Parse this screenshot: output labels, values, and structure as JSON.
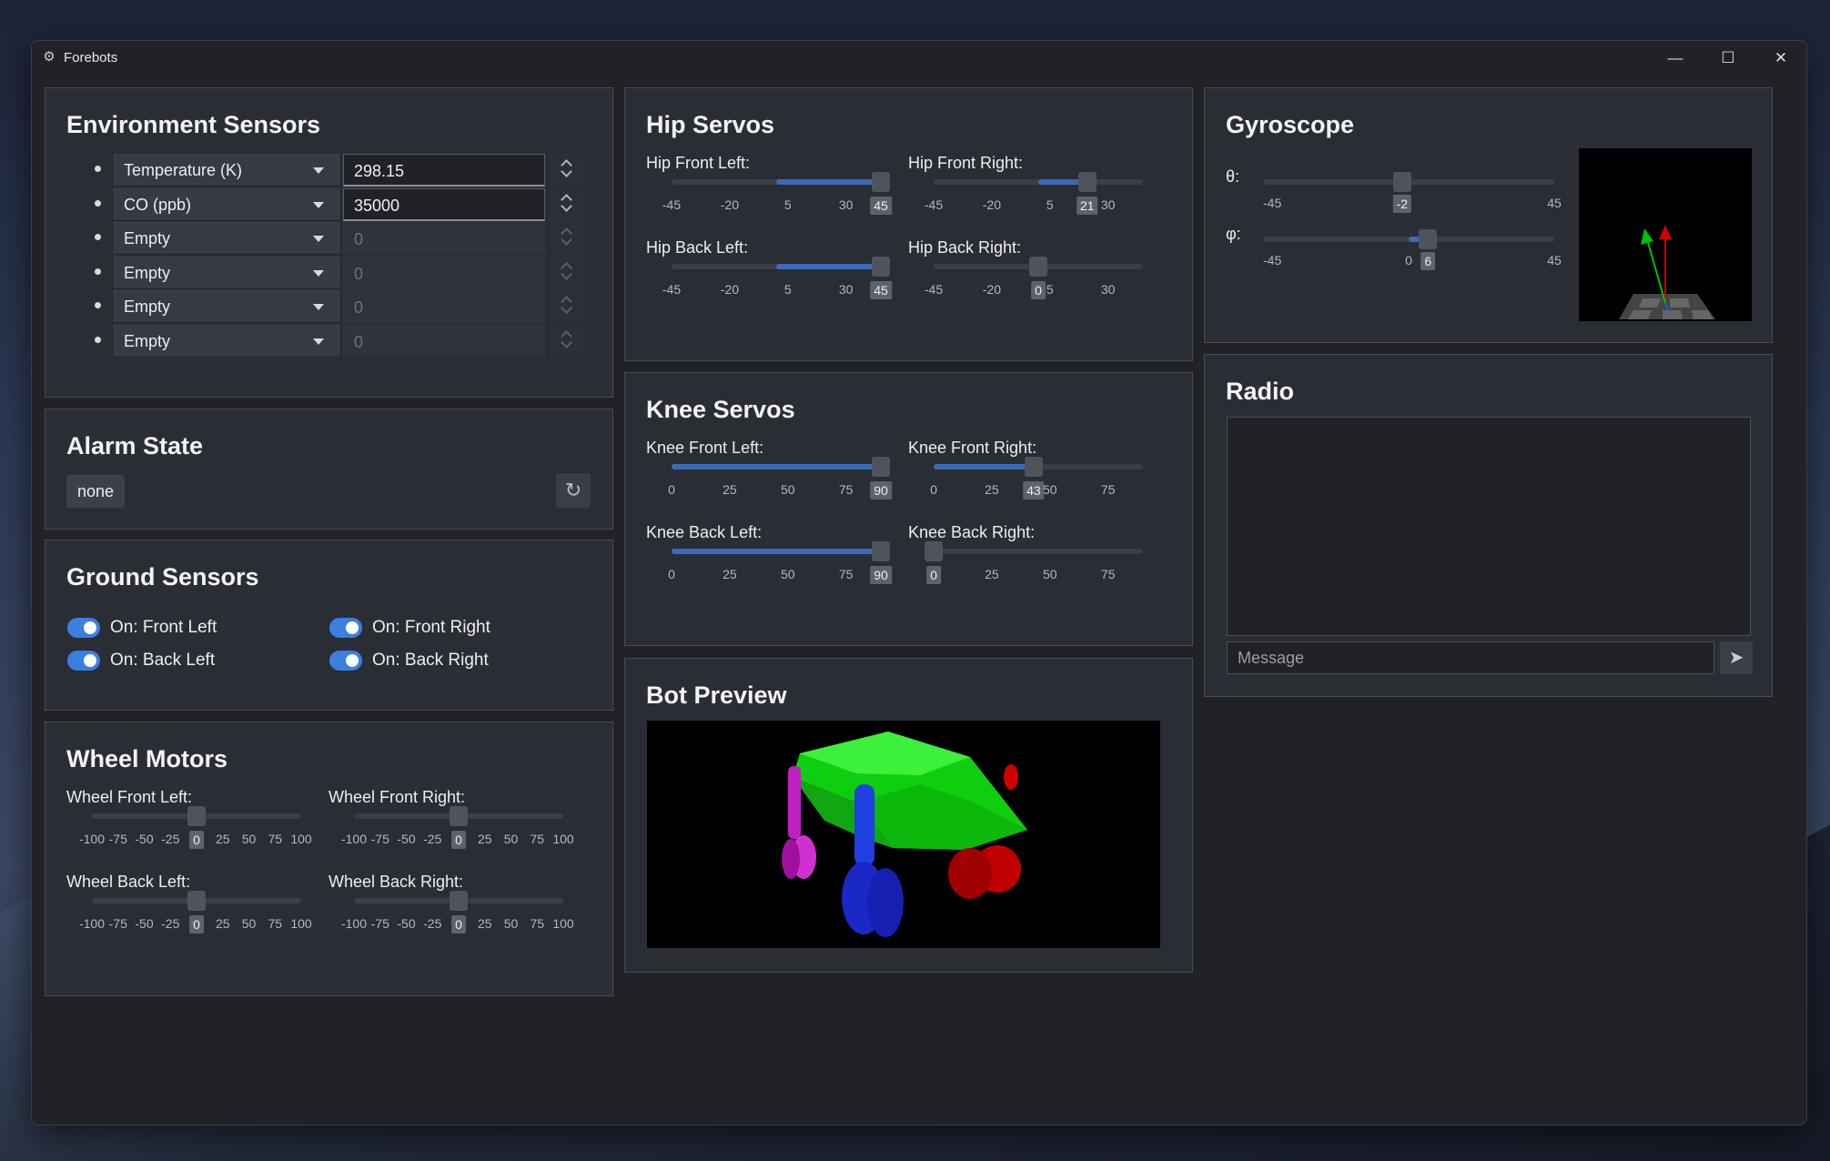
{
  "window": {
    "title": "Forebots",
    "icon": "gear-icon",
    "minimize_icon": "minimize-icon",
    "maximize_icon": "maximize-icon",
    "close_icon": "close-icon"
  },
  "env": {
    "title": "Environment Sensors",
    "spin_up_icon": "chevron-up-icon",
    "spin_down_icon": "chevron-down-icon",
    "rows": [
      {
        "sensor": "Temperature (K)",
        "value": "298.15",
        "enabled": true
      },
      {
        "sensor": "CO (ppb)",
        "value": "35000",
        "enabled": true
      },
      {
        "sensor": "Empty",
        "value": "0",
        "enabled": false
      },
      {
        "sensor": "Empty",
        "value": "0",
        "enabled": false
      },
      {
        "sensor": "Empty",
        "value": "0",
        "enabled": false
      },
      {
        "sensor": "Empty",
        "value": "0",
        "enabled": false
      }
    ]
  },
  "alarm": {
    "title": "Alarm State",
    "state": "none",
    "reset_icon": "reset-icon"
  },
  "ground": {
    "title": "Ground Sensors",
    "items": [
      {
        "label": "On: Front Left",
        "on": true
      },
      {
        "label": "On: Front Right",
        "on": true
      },
      {
        "label": "On: Back Left",
        "on": true
      },
      {
        "label": "On: Back Right",
        "on": true
      }
    ]
  },
  "wheels": {
    "title": "Wheel Motors",
    "ticks": [
      "-100",
      "-75",
      "-50",
      "-25",
      "0",
      "25",
      "50",
      "75",
      "100"
    ],
    "min": -100,
    "max": 100,
    "sliders": [
      {
        "label": "Wheel Front Left:",
        "value": 0
      },
      {
        "label": "Wheel Front Right:",
        "value": 0
      },
      {
        "label": "Wheel Back Left:",
        "value": 0
      },
      {
        "label": "Wheel Back Right:",
        "value": 0
      }
    ]
  },
  "hip": {
    "title": "Hip Servos",
    "ticks": [
      "-45",
      "-20",
      "5",
      "30"
    ],
    "min": -45,
    "max": 45,
    "sliders": [
      {
        "label": "Hip Front Left:",
        "value": 45
      },
      {
        "label": "Hip Front Right:",
        "value": 21
      },
      {
        "label": "Hip Back Left:",
        "value": 45
      },
      {
        "label": "Hip Back Right:",
        "value": 0
      }
    ]
  },
  "knee": {
    "title": "Knee Servos",
    "ticks": [
      "0",
      "25",
      "50",
      "75"
    ],
    "min": 0,
    "max": 90,
    "sliders": [
      {
        "label": "Knee Front Left:",
        "value": 90
      },
      {
        "label": "Knee Front Right:",
        "value": 43
      },
      {
        "label": "Knee Back Left:",
        "value": 90
      },
      {
        "label": "Knee Back Right:",
        "value": 0
      }
    ]
  },
  "preview": {
    "title": "Bot Preview"
  },
  "gyro": {
    "title": "Gyroscope",
    "sliders": [
      {
        "label": "θ:",
        "min_label": "-45",
        "max_label": "45",
        "value": -2
      },
      {
        "label": "φ:",
        "min_label": "-45",
        "max_label": "45",
        "zero_label": "0",
        "value": 6
      }
    ]
  },
  "radio": {
    "title": "Radio",
    "placeholder": "Message",
    "send_icon": "send-icon"
  }
}
